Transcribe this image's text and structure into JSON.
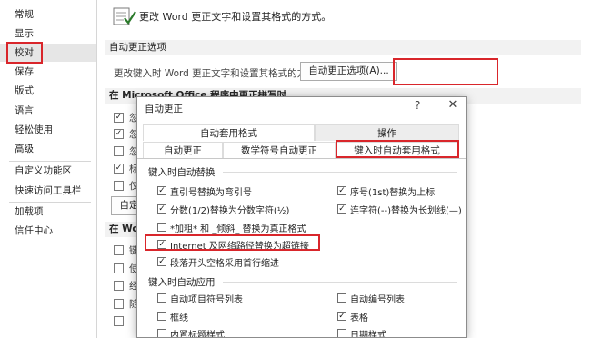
{
  "sidebar": {
    "items": [
      {
        "label": "常规"
      },
      {
        "label": "显示"
      },
      {
        "label": "校对"
      },
      {
        "label": "保存"
      },
      {
        "label": "版式"
      },
      {
        "label": "语言"
      },
      {
        "label": "轻松使用"
      },
      {
        "label": "高级"
      },
      {
        "label": "自定义功能区"
      },
      {
        "label": "快速访问工具栏"
      },
      {
        "label": "加载项"
      },
      {
        "label": "信任中心"
      }
    ],
    "active_index": 2
  },
  "main": {
    "intro": "更改 Word 更正文字和设置其格式的方式。",
    "autocorrect_section": "自动更正选项",
    "autocorrect_desc": "更改键入时 Word 更正文字和设置其格式的方式：",
    "autocorrect_button": "自动更正选项(A)...",
    "office_section": "在 Microsoft Office 程序中更正拼写时",
    "office_checks": [
      {
        "text": "忽",
        "checked": true
      },
      {
        "text": "忽",
        "checked": true
      },
      {
        "text": "忽",
        "checked": false
      },
      {
        "text": "标",
        "checked": true
      },
      {
        "text": "仅",
        "checked": false
      }
    ],
    "office_button_fragment": "自定",
    "word_section": "在 Wo",
    "word_checks": [
      {
        "text": "键",
        "checked": false
      },
      {
        "text": "使",
        "checked": false
      },
      {
        "text": "经",
        "checked": false
      },
      {
        "text": "随",
        "checked": false
      },
      {
        "text": "",
        "checked": false
      }
    ]
  },
  "dialog": {
    "title": "自动更正",
    "help": "?",
    "close": "✕",
    "tabs_upper": [
      "自动套用格式",
      "操作"
    ],
    "tabs_lower": [
      "自动更正",
      "数学符号自动更正",
      "键入时自动套用格式"
    ],
    "active_tab": "键入时自动套用格式",
    "replace_group": "键入时自动替换",
    "replace_left": [
      {
        "label": "直引号替换为弯引号",
        "checked": true
      },
      {
        "label": "分数(1/2)替换为分数字符(½)",
        "checked": true
      },
      {
        "label": "*加粗* 和 _倾斜_ 替换为真正格式",
        "checked": false
      },
      {
        "label": "Internet 及网络路径替换为超链接",
        "checked": true
      },
      {
        "label": "段落开头空格采用首行缩进",
        "checked": true
      }
    ],
    "replace_right": [
      {
        "label": "序号(1st)替换为上标",
        "checked": true
      },
      {
        "label": "连字符(--)替换为长划线(—)",
        "checked": true
      }
    ],
    "apply_group": "键入时自动应用",
    "apply_left": [
      {
        "label": "自动项目符号列表",
        "checked": false
      },
      {
        "label": "框线",
        "checked": false
      },
      {
        "label": "内置标题样式",
        "checked": false
      }
    ],
    "apply_right": [
      {
        "label": "自动编号列表",
        "checked": false
      },
      {
        "label": "表格",
        "checked": true
      },
      {
        "label": "日期样式",
        "checked": false
      }
    ]
  },
  "colors": {
    "highlight_border": "#d9262b",
    "active_sidebar_bg": "#e6e6e6",
    "section_bg": "#f2f2f2"
  }
}
